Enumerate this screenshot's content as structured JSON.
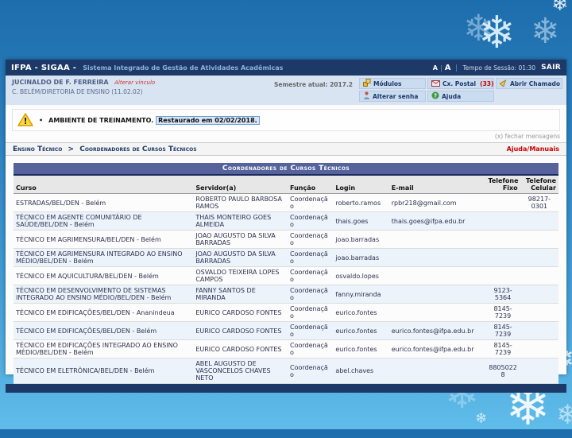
{
  "header": {
    "brand": "IFPA - SIGAA -",
    "app_title": "Sistema Integrado de Gestão de Atividades Acadêmicas",
    "font_small": "A",
    "font_separator": "|",
    "font_large": "A",
    "session_label": "Tempo de Sessão: 01:30",
    "logout_label": "SAIR"
  },
  "userbar": {
    "user_name": "JUCINALDO DE F. FERREIRA",
    "change_bond_label": "Alterar vínculo",
    "unit": "C. BELÉM/DIRETORIA DE ENSINO (11.02.02)",
    "semester_label": "Semestre atual: 2017.2",
    "buttons": [
      {
        "label": "Módulos",
        "icon": "modules-icon"
      },
      {
        "label": "Cx. Postal",
        "count": "(33)",
        "icon": "mailbox-icon"
      },
      {
        "label": "Abrir Chamado",
        "icon": "open-ticket-icon"
      },
      {
        "label": "Alterar senha",
        "icon": "change-password-icon"
      },
      {
        "label": "Ajuda",
        "icon": "help-icon"
      }
    ]
  },
  "messages": {
    "bullet": "•",
    "warning_prefix": "AMBIENTE DE TREINAMENTO.",
    "warning_highlight": "Restaurado em 02/02/2018.",
    "close_label": "(x) fechar mensagens"
  },
  "breadcrumb": {
    "section": "Ensino Técnico",
    "separator": ">",
    "page": "Coordenadores de Cursos Técnicos",
    "help_link": "Ajuda/Manuais"
  },
  "table": {
    "title": "Coordenadores de Cursos Técnicos",
    "columns": [
      "Curso",
      "Servidor(a)",
      "Função",
      "Login",
      "E-mail",
      "Telefone Fixo",
      "Telefone Celular"
    ],
    "row_keys": [
      "curso",
      "servidor",
      "funcao",
      "login",
      "email",
      "fixo",
      "celular"
    ],
    "rows": [
      {
        "curso": "ESTRADAS/BEL/DEN - Belém",
        "servidor": "ROBERTO PAULO BARBOSA RAMOS",
        "funcao": "Coordenação",
        "login": "roberto.ramos",
        "email": "rpbr218@gmail.com",
        "fixo": "",
        "celular": "98217-0301"
      },
      {
        "curso": "TÉCNICO EM AGENTE COMUNITÁRIO DE SAÚDE/BEL/DEN - Belém",
        "servidor": "THAIS MONTEIRO GOES ALMEIDA",
        "funcao": "Coordenação",
        "login": "thais.goes",
        "email": "thais.goes@ifpa.edu.br",
        "fixo": "",
        "celular": ""
      },
      {
        "curso": "TÉCNICO EM AGRIMENSURA/BEL/DEN - Belém",
        "servidor": "JOAO AUGUSTO DA SILVA BARRADAS",
        "funcao": "Coordenação",
        "login": "joao.barradas",
        "email": "",
        "fixo": "",
        "celular": ""
      },
      {
        "curso": "TÉCNICO EM AGRIMENSURA INTEGRADO AO ENSINO MÉDIO/BEL/DEN - Belém",
        "servidor": "JOAO AUGUSTO DA SILVA BARRADAS",
        "funcao": "Coordenação",
        "login": "joao.barradas",
        "email": "",
        "fixo": "",
        "celular": ""
      },
      {
        "curso": "TÉCNICO EM AQUICULTURA/BEL/DEN - Belém",
        "servidor": "OSVALDO TEIXEIRA LOPES CAMPOS",
        "funcao": "Coordenação",
        "login": "osvaldo.lopes",
        "email": "",
        "fixo": "",
        "celular": ""
      },
      {
        "curso": "TÉCNICO EM DESENVOLVIMENTO DE SISTEMAS INTEGRADO AO ENSINO MÉDIO/BEL/DEN - Belém",
        "servidor": "FANNY SANTOS DE MIRANDA",
        "funcao": "Coordenação",
        "login": "fanny.miranda",
        "email": "",
        "fixo": "9123-5364",
        "celular": ""
      },
      {
        "curso": "TÉCNICO EM EDIFICAÇÕES/BEL/DEN - Ananindeua",
        "servidor": "EURICO CARDOSO FONTES",
        "funcao": "Coordenação",
        "login": "eurico.fontes",
        "email": "",
        "fixo": "8145-7239",
        "celular": ""
      },
      {
        "curso": "TÉCNICO EM EDIFICAÇÕES/BEL/DEN - Belém",
        "servidor": "EURICO CARDOSO FONTES",
        "funcao": "Coordenação",
        "login": "eurico.fontes",
        "email": "eurico.fontes@ifpa.edu.br",
        "fixo": "8145-7239",
        "celular": ""
      },
      {
        "curso": "TÉCNICO EM EDIFICAÇÕES INTEGRADO AO ENSINO MÉDIO/BEL/DEN - Belém",
        "servidor": "EURICO CARDOSO FONTES",
        "funcao": "Coordenação",
        "login": "eurico.fontes",
        "email": "eurico.fontes@ifpa.edu.br",
        "fixo": "8145-7239",
        "celular": ""
      },
      {
        "curso": "TÉCNICO EM ELETRÔNICA/BEL/DEN - Belém",
        "servidor": "ABEL AUGUSTO DE VASCONCELOS CHAVES NETO",
        "funcao": "Coordenação",
        "login": "abel.chaves",
        "email": "",
        "fixo": "88050228",
        "celular": ""
      }
    ]
  },
  "colors": {
    "navy_bar": "#1d3968",
    "userbar_bg": "#d8e4f2",
    "table_title_bg": "#56629c",
    "alt_row_bg": "#ecf3fb",
    "alert_red": "#cc0000",
    "slide_bg_top": "#1e6dac",
    "slide_bg_bottom": "#60bce9"
  }
}
